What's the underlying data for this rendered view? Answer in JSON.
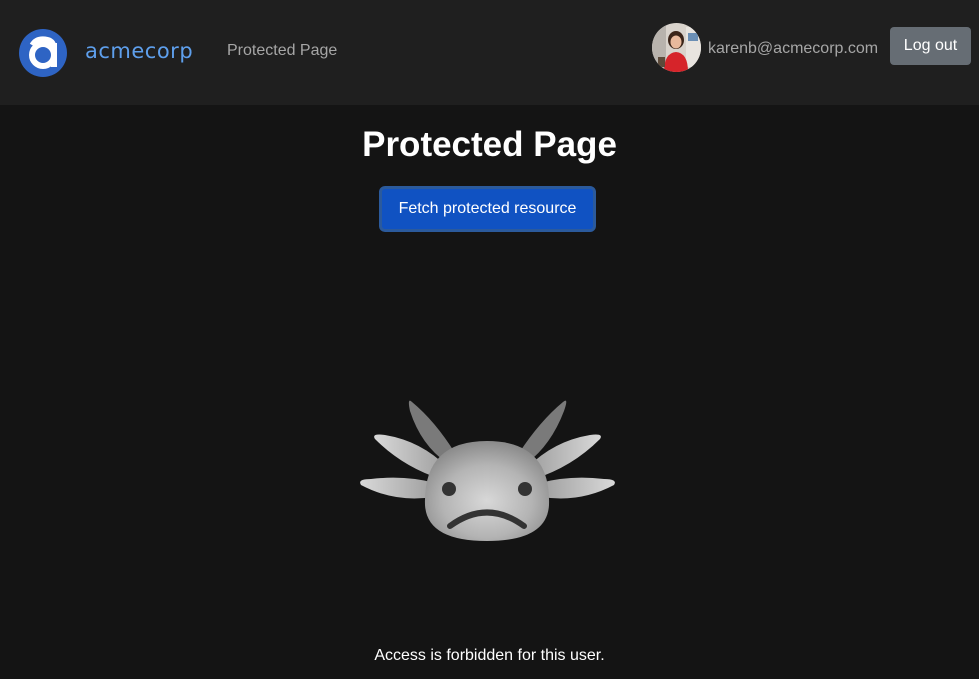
{
  "header": {
    "brand": "acmecorp",
    "nav_link": "Protected Page",
    "user_email": "karenb@acmecorp.com",
    "logout_label": "Log out",
    "logo_icon": "acmecorp-logo-icon",
    "avatar_icon": "user-avatar-photo"
  },
  "main": {
    "title": "Protected Page",
    "fetch_button_label": "Fetch protected resource",
    "illustration_icon": "sad-axolotl-icon",
    "message": "Access is forbidden for this user."
  },
  "colors": {
    "background": "#141414",
    "navbar": "#1f1f1f",
    "brand": "#5e9fec",
    "primary_button": "#1052c2",
    "logout_button": "#666d74"
  }
}
